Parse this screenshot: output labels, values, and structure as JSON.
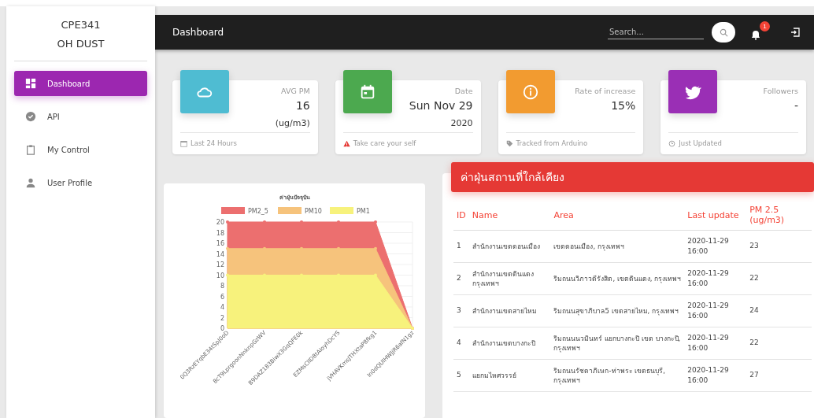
{
  "sidebar": {
    "title": "CPE341",
    "subtitle": "OH DUST",
    "items": [
      {
        "label": "Dashboard",
        "selected": true
      },
      {
        "label": "API",
        "selected": false
      },
      {
        "label": "My Control",
        "selected": false
      },
      {
        "label": "User Profile",
        "selected": false
      }
    ]
  },
  "topbar": {
    "title": "Dashboard",
    "search": {
      "placeholder": "Search..."
    },
    "notification_count": "1"
  },
  "stat_cards": [
    {
      "color": "#4fbcd2",
      "label": "AVG PM",
      "value": "16",
      "unit": "(ug/m3)",
      "footer": "Last 24 Hours"
    },
    {
      "color": "#4ca94f",
      "label": "Date",
      "value": "Sun Nov 29",
      "unit": "2020",
      "footer": "Take care your self"
    },
    {
      "color": "#f29b30",
      "label": "Rate of increase",
      "value": "15%",
      "footer": "Tracked from Arduino"
    },
    {
      "color": "#9a2fb5",
      "label": "Followers",
      "value": "-",
      "footer": "Just Updated"
    }
  ],
  "chart": {
    "chart_data": {
      "type": "area",
      "title": "ค่าฝุ่นปัจจุบัน",
      "categories": [
        "0Q3RzEYqbE34tSpJ0oD",
        "8cT9LprgoonNnknpGzWV",
        "B9DAZ183BiwX3GqQFE0k",
        "EZMsCllD8tAioyhDcYS",
        "jVHAVKmsJTHXtaP8fkg1",
        "ln0dQUlHWJjR6afN1gz"
      ],
      "series": [
        {
          "name": "PM2_5",
          "color": "#ec6f6f",
          "values": [
            20,
            20,
            20,
            20,
            20,
            0
          ]
        },
        {
          "name": "PM10",
          "color": "#f6c37c",
          "values": [
            15,
            15,
            15,
            15,
            15,
            0
          ]
        },
        {
          "name": "PM1",
          "color": "#f7f27c",
          "values": [
            10,
            10,
            10,
            10,
            10,
            0
          ]
        }
      ],
      "ylim": [
        0,
        20
      ],
      "grid": true,
      "legend": "top",
      "yticks": [
        0,
        2,
        4,
        6,
        8,
        10,
        12,
        14,
        16,
        18,
        20
      ]
    }
  },
  "table": {
    "title": "ค่าฝุ่นสถานที่ใกล้เคียง",
    "columns": [
      "ID",
      "Name",
      "Area",
      "Last update",
      "PM 2.5 (ug/m3)"
    ],
    "rows": [
      [
        "1",
        "สำนักงานเขตดอนเมือง",
        "เขตดอนเมือง, กรุงเทพฯ",
        "2020-11-29 16:00",
        "23"
      ],
      [
        "2",
        "สำนักงานเขตดินแดง กรุงเทพฯ",
        "ริมถนนวิภาวดีรังสิต, เขตดินแดง, กรุงเทพฯ",
        "2020-11-29 16:00",
        "22"
      ],
      [
        "3",
        "สำนักงานเขตสายไหม",
        "ริมถนนสุขาภิบาล5 เขตสายไหม, กรุงเทพฯ",
        "2020-11-29 16:00",
        "24"
      ],
      [
        "4",
        "สำนักงานเขตบางกะปิ",
        "ริมถนนนวมินทร์ แยกบางกะปิ เขต บางกะปิ, กรุงเทพฯ",
        "2020-11-29 16:00",
        "22"
      ],
      [
        "5",
        "แยกมไหศวรรย์",
        "ริมถนนรัชดาภิเษก-ท่าพระ เขตธนบุรี, กรุงเทพฯ",
        "2020-11-29 16:00",
        "27"
      ]
    ]
  }
}
